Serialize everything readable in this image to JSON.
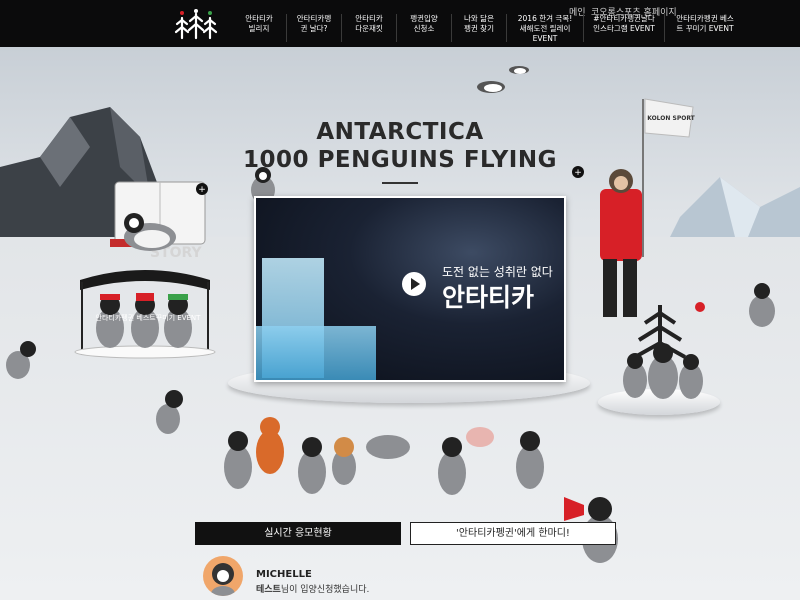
{
  "topbar": {
    "util_links": [
      "메인",
      "코오롱스포츠 홈페이지"
    ],
    "nav": [
      "안타티카 빌리지",
      "안타티카펭귄 날다?",
      "안타티카 다운재킷",
      "펭귄입양 신청소",
      "나와 닮은 펭귄 찾기",
      "2016 한겨 극복! 새해도전 릴레이 EVENT",
      "#안타티카펭귄날다 인스타그램 EVENT",
      "안타티카펭귄 베스트 꾸미기 EVENT"
    ]
  },
  "hero": {
    "title_line1": "ANTARCTICA",
    "title_line2": "1000 PENGUINS FLYING",
    "hashtag": "#안타티카펭귄날다"
  },
  "video": {
    "caption_small": "도전 없는 성취란 없다",
    "caption_large": "안타티카"
  },
  "decor": {
    "event_sign": "안타티카펭귄 베스트꾸미기 EVENT",
    "flag_text": "KOLON SPORT",
    "book_text": "STORY"
  },
  "buttons": {
    "status": "실시간 응모현황",
    "comment": "'안타티카펭귄'에게 한마디!"
  },
  "comment": {
    "name": "MICHELLE",
    "user": "테스트",
    "message": "님이 입양신청했습니다."
  },
  "colors": {
    "topbar": "#0b0b0c",
    "accent_red": "#d72027",
    "ground": "#e9ebee"
  }
}
